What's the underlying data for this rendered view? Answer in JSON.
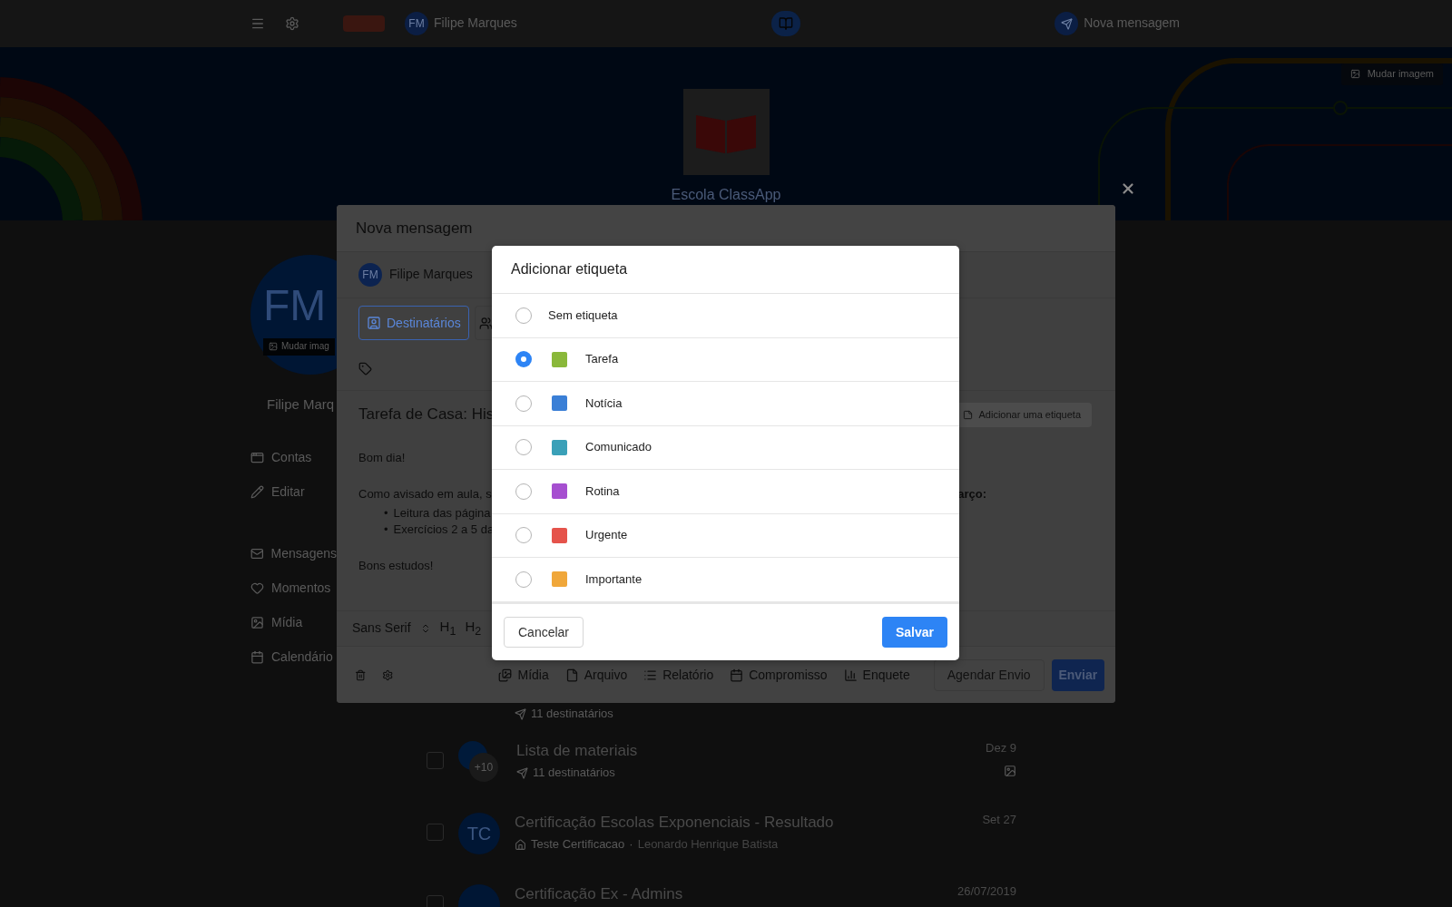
{
  "top_bar": {
    "user": {
      "initials": "FM",
      "name": "Filipe Marques"
    },
    "new_message": "Nova mensagem"
  },
  "banner": {
    "school": "Escola ClassApp",
    "change_image": "Mudar imagem"
  },
  "profile": {
    "initials": "FM",
    "change_image": "Mudar imag",
    "name": "Filipe Marq"
  },
  "sidebar": {
    "groups": [
      {
        "items": [
          {
            "label": "Contas"
          },
          {
            "label": "Editar"
          }
        ]
      },
      {
        "items": [
          {
            "label": "Mensagens"
          },
          {
            "label": "Momentos"
          },
          {
            "label": "Mídia"
          },
          {
            "label": "Calendário"
          }
        ]
      }
    ]
  },
  "messages": [
    {
      "kind": "partial",
      "recipients": "11 destinatários"
    },
    {
      "kind": "sent",
      "checked": false,
      "title": "Lista de materiais",
      "extra": "+10",
      "recipients": "11 destinatários",
      "date": "Dez 9"
    },
    {
      "kind": "received",
      "checked": false,
      "initials": "TC",
      "title": "Certificação Escolas Exponenciais - Resultado",
      "group": "Teste Certificacao",
      "separator": "·",
      "author": "Leonardo Henrique Batista",
      "date": "Set 27"
    },
    {
      "kind": "title_only",
      "checked": false,
      "title": "Certificação Ex - Admins",
      "date": "26/07/2019"
    }
  ],
  "compose": {
    "title": "Nova mensagem",
    "author": {
      "initials": "FM",
      "name": "Filipe Marques"
    },
    "recipients_button": "Destinatários",
    "subject": "Tarefa de Casa: His",
    "add_tag": "Adicionar uma etiqueta",
    "body": [
      {
        "kind": "paragraph",
        "text": "Bom dia!"
      },
      {
        "kind": "split",
        "left": "Como avisado em aula, s",
        "right": "arço:"
      },
      {
        "kind": "bullets",
        "marker": "•",
        "items": [
          "Leitura das página",
          "Exercícios 2 a 5 da"
        ]
      },
      {
        "kind": "paragraph",
        "text": "Bons estudos!"
      }
    ],
    "toolbar": {
      "font": "Sans Serif",
      "headings": [
        "H$_{1}$",
        "H$_{2}$"
      ]
    },
    "attachments": [
      "Mídia",
      "Arquivo",
      "Relatório",
      "Compromisso",
      "Enquete"
    ],
    "schedule": "Agendar Envio",
    "send": "Enviar"
  },
  "tag_dialog": {
    "title": "Adicionar etiqueta",
    "options": [
      {
        "label": "Sem etiqueta",
        "selected": false
      },
      {
        "label": "Tarefa",
        "color": "#8ab83a",
        "selected": true
      },
      {
        "label": "Notícia",
        "color": "#3a7fd6",
        "selected": false
      },
      {
        "label": "Comunicado",
        "color": "#3aa0b8",
        "selected": false
      },
      {
        "label": "Rotina",
        "color": "#a64fd0",
        "selected": false
      },
      {
        "label": "Urgente",
        "color": "#e5534b",
        "selected": false
      },
      {
        "label": "Importante",
        "color": "#f0a73a",
        "selected": false
      }
    ],
    "cancel": "Cancelar",
    "save": "Salvar"
  }
}
